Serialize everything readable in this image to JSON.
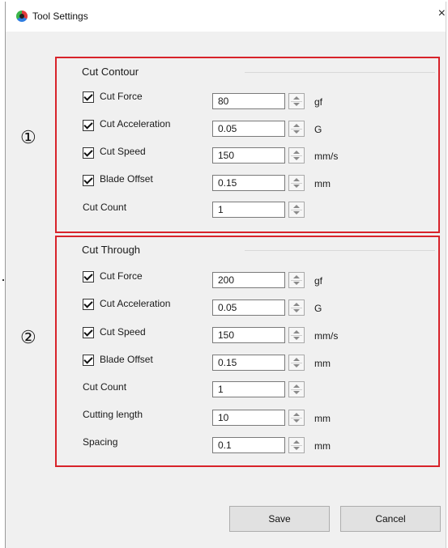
{
  "window": {
    "title": "Tool Settings",
    "close_glyph": "×",
    "icon": "app-icon"
  },
  "markers": {
    "one": "①",
    "two": "②"
  },
  "cut_contour": {
    "title": "Cut Contour",
    "rows": [
      {
        "label": "Cut Force",
        "checked": true,
        "value": "80",
        "unit": "gf"
      },
      {
        "label": "Cut Acceleration",
        "checked": true,
        "value": "0.05",
        "unit": "G"
      },
      {
        "label": "Cut Speed",
        "checked": true,
        "value": "150",
        "unit": "mm/s"
      },
      {
        "label": "Blade Offset",
        "checked": true,
        "value": "0.15",
        "unit": "mm"
      },
      {
        "label": "Cut Count",
        "checked": null,
        "value": "1",
        "unit": ""
      }
    ]
  },
  "cut_through": {
    "title": "Cut Through",
    "rows": [
      {
        "label": "Cut Force",
        "checked": true,
        "value": "200",
        "unit": "gf"
      },
      {
        "label": "Cut Acceleration",
        "checked": true,
        "value": "0.05",
        "unit": "G"
      },
      {
        "label": "Cut Speed",
        "checked": true,
        "value": "150",
        "unit": "mm/s"
      },
      {
        "label": "Blade Offset",
        "checked": true,
        "value": "0.15",
        "unit": "mm"
      },
      {
        "label": "Cut Count",
        "checked": null,
        "value": "1",
        "unit": ""
      },
      {
        "label": "Cutting length",
        "checked": null,
        "value": "10",
        "unit": "mm"
      },
      {
        "label": "Spacing",
        "checked": null,
        "value": "0.1",
        "unit": "mm"
      }
    ]
  },
  "buttons": {
    "save": "Save",
    "cancel": "Cancel"
  },
  "colors": {
    "group_border": "#d8232a",
    "dialog_bg": "#f0f0f0"
  }
}
